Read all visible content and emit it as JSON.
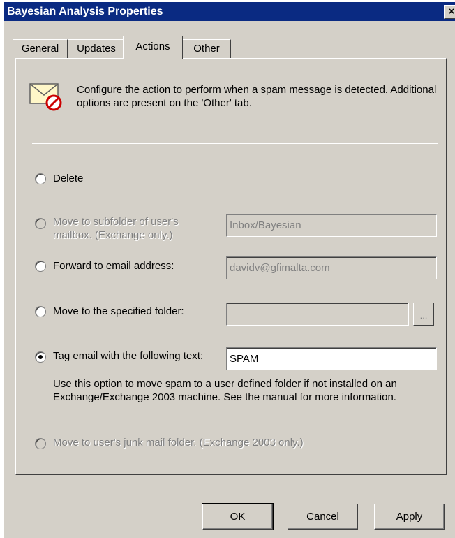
{
  "window": {
    "title": "Bayesian Analysis Properties",
    "close_glyph": "×"
  },
  "tabs": [
    {
      "label": "General",
      "active": false
    },
    {
      "label": "Updates",
      "active": false
    },
    {
      "label": "Actions",
      "active": true
    },
    {
      "label": "Other",
      "active": false
    }
  ],
  "header": {
    "icon": "spam-envelope-icon",
    "description": "Configure the action to perform when a spam message is detected. Additional options are present on the 'Other' tab."
  },
  "options": {
    "delete": {
      "label": "Delete",
      "selected": false,
      "enabled": true
    },
    "move_subfolder": {
      "label": "Move to subfolder of user's mailbox. (Exchange only.)",
      "selected": false,
      "enabled": false,
      "value": "Inbox/Bayesian"
    },
    "forward": {
      "label": "Forward to email address:",
      "selected": false,
      "enabled": true,
      "value": "davidv@gfimalta.com"
    },
    "move_folder": {
      "label": "Move to the specified folder:",
      "selected": false,
      "enabled": true,
      "value": "",
      "browse_label": "..."
    },
    "tag": {
      "label": "Tag email with the following text:",
      "selected": true,
      "enabled": true,
      "value": "SPAM"
    },
    "tag_note": "Use this option to move spam to a user defined folder if not installed on an Exchange/Exchange 2003 machine. See the manual for more information.",
    "junk": {
      "label": "Move to user's junk mail folder. (Exchange 2003 only.)",
      "selected": false,
      "enabled": false
    }
  },
  "buttons": {
    "ok": "OK",
    "cancel": "Cancel",
    "apply": "Apply"
  },
  "colors": {
    "titlebar": "#0a2a82",
    "dialog_bg": "#d4d0c8",
    "disabled_text": "#808080"
  }
}
